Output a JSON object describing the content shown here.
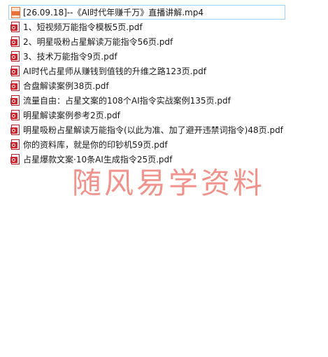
{
  "files": [
    {
      "name": "[26.09.18]--《AI时代年赚千万》直播讲解.mp4",
      "type": "mp4",
      "icon": "mp4-file-icon",
      "selected": true
    },
    {
      "name": "1、短视频万能指令模板5页.pdf",
      "type": "pdf",
      "icon": "pdf-file-icon"
    },
    {
      "name": "2、明星吸粉占星解读万能指令56页.pdf",
      "type": "pdf",
      "icon": "pdf-file-icon"
    },
    {
      "name": "3、技术万能指令9页.pdf",
      "type": "pdf",
      "icon": "pdf-file-icon"
    },
    {
      "name": "AI时代占星师从赚钱到值钱的升维之路123页.pdf",
      "type": "pdf",
      "icon": "pdf-file-icon"
    },
    {
      "name": "合盘解读案例38页.pdf",
      "type": "pdf",
      "icon": "pdf-file-icon"
    },
    {
      "name": "流量自由：占星文案的108个AI指令实战案例135页.pdf",
      "type": "pdf",
      "icon": "pdf-file-icon"
    },
    {
      "name": "明星解读案例参考2页.pdf",
      "type": "pdf",
      "icon": "pdf-file-icon"
    },
    {
      "name": "明星吸粉占星解读万能指令(以此为准、加了避开违禁词指令)48页.pdf",
      "type": "pdf",
      "icon": "pdf-file-icon"
    },
    {
      "name": "你的资料库，就是你的印钞机59页.pdf",
      "type": "pdf",
      "icon": "pdf-file-icon"
    },
    {
      "name": "占星爆款文案·10条AI生成指令25页.pdf",
      "type": "pdf",
      "icon": "pdf-file-icon"
    }
  ],
  "watermark": "随风易学资料",
  "colors": {
    "selection_border": "#99d1ff",
    "pdf_red": "#d0202a",
    "mp4_orange": "#e8703a",
    "watermark": "#f08078"
  }
}
